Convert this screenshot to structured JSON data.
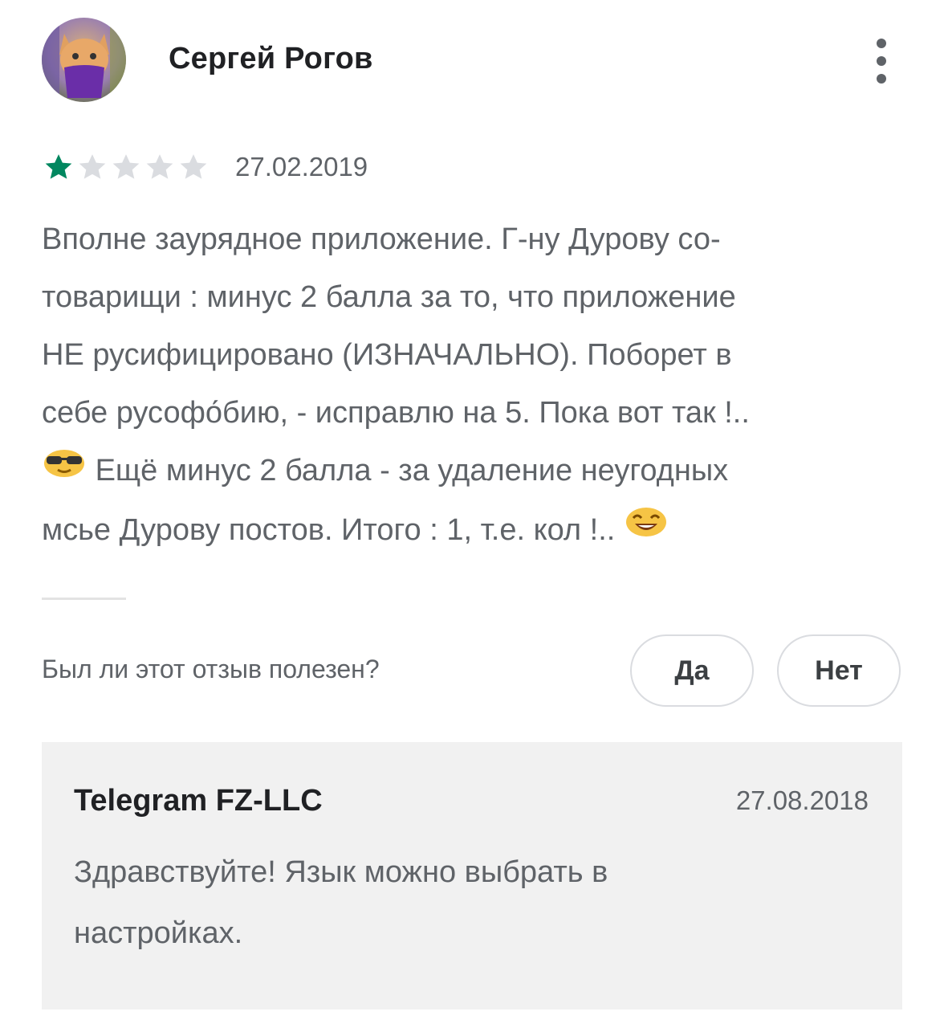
{
  "review": {
    "author": "Сергей Рогов",
    "rating": 1,
    "max_rating": 5,
    "date": "27.02.2019",
    "text_lines": [
      "Вполне заурядное приложение. Г-ну Дурову со-",
      "товарищи : минус 2 балла за то, что приложение",
      "НЕ русифицировано (ИЗНАЧАЛЬНО). Поборет в",
      "себе русофо́бию, - исправлю на 5. Пока вот так !..",
      "Ещё минус 2 балла - за удаление неугодных",
      "мсье Дурову постов. Итого : 1, т.е. кол !.."
    ],
    "emoji_1": "sunglasses-emoji",
    "emoji_2": "grinning-emoji"
  },
  "helpful": {
    "question": "Был ли этот отзыв полезен?",
    "yes_label": "Да",
    "no_label": "Нет"
  },
  "reply": {
    "author": "Telegram FZ-LLC",
    "date": "27.08.2018",
    "text_lines": [
      "Здравствуйте! Язык можно выбрать в",
      "настройках."
    ]
  },
  "colors": {
    "star_filled": "#01875f",
    "star_empty": "#dadce0",
    "reply_bg": "#f1f1f1"
  }
}
